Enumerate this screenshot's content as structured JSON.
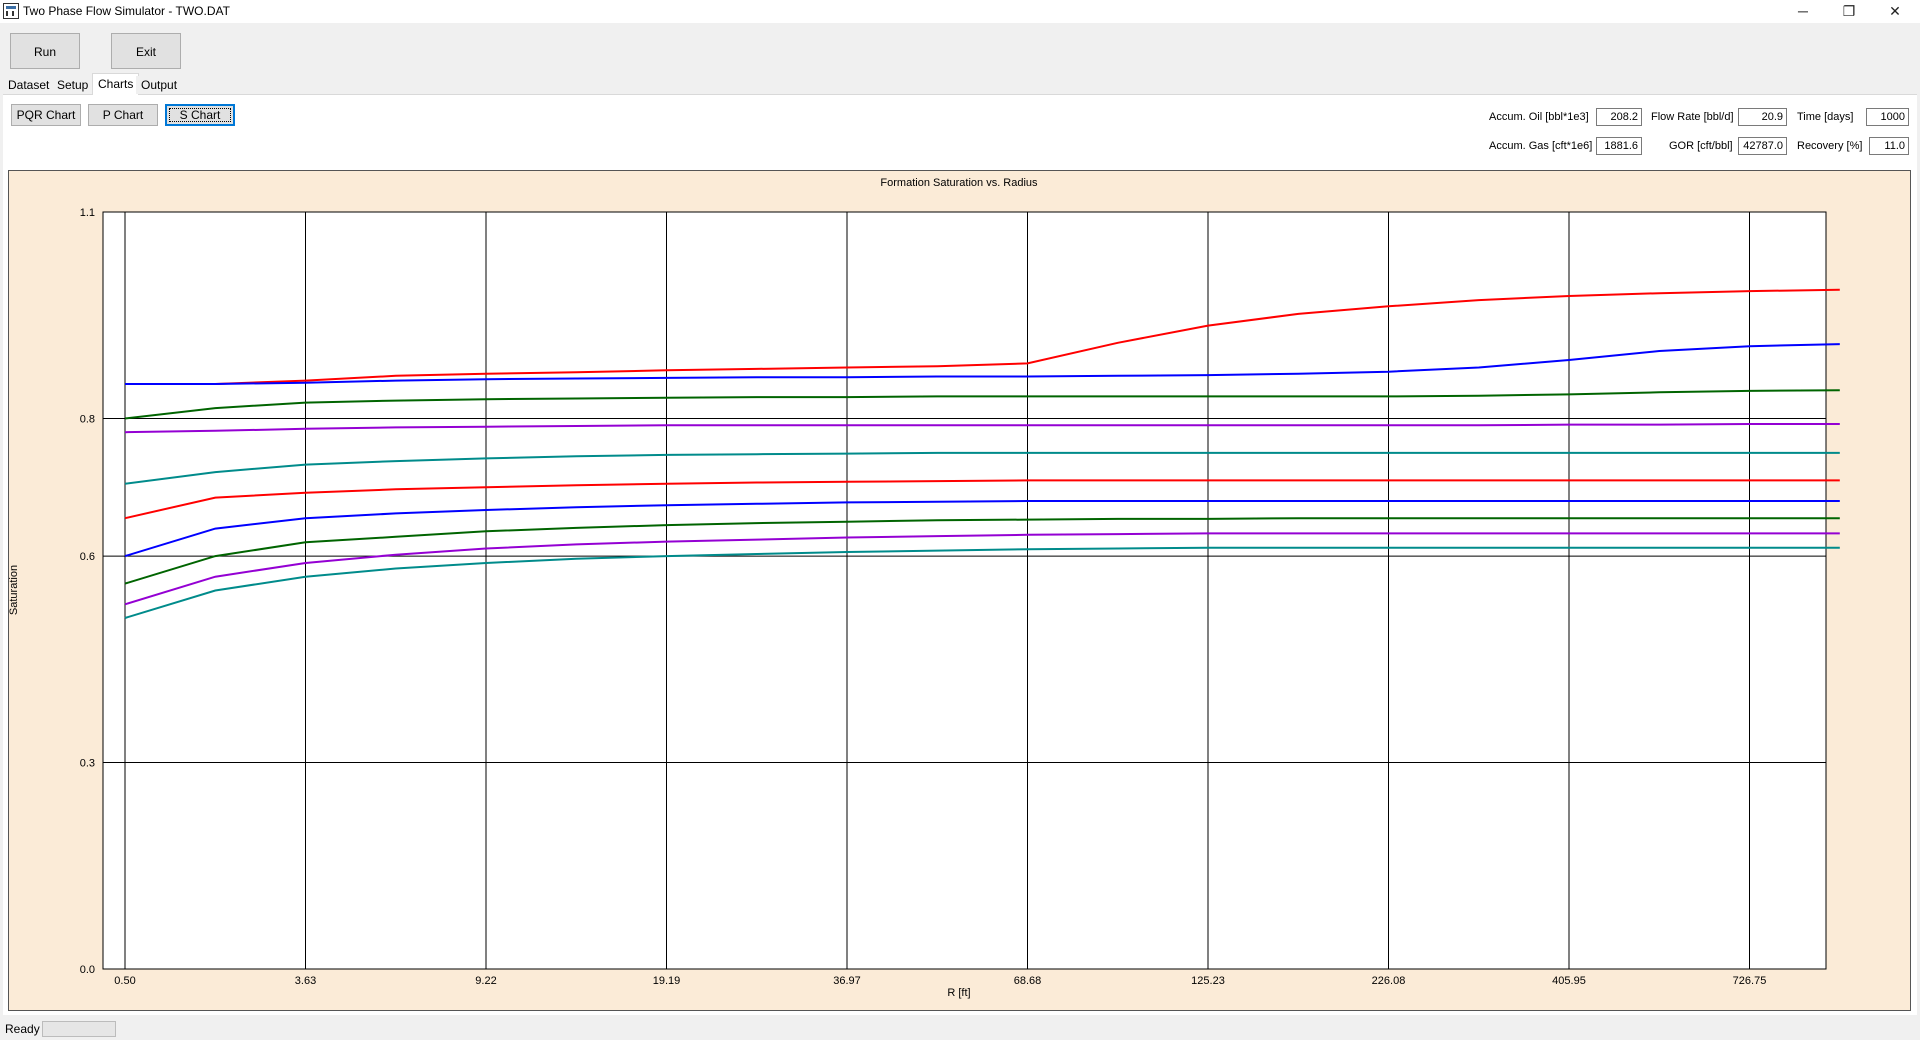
{
  "window": {
    "title": "Two Phase Flow Simulator - TWO.DAT",
    "minimize": "─",
    "restore": "❐",
    "close": "✕"
  },
  "toolbar": {
    "run_label": "Run",
    "exit_label": "Exit"
  },
  "tabs": [
    {
      "label": "Dataset"
    },
    {
      "label": "Setup"
    },
    {
      "label": "Charts",
      "active": true
    },
    {
      "label": "Output"
    }
  ],
  "chart_buttons": [
    {
      "label": "PQR Chart"
    },
    {
      "label": "P Chart"
    },
    {
      "label": "S Chart",
      "selected": true
    }
  ],
  "stats": {
    "accum_oil_label": "Accum. Oil [bbl*1e3]",
    "accum_oil": "208.2",
    "flow_rate_label": "Flow Rate [bbl/d]",
    "flow_rate": "20.9",
    "time_label": "Time [days]",
    "time": "1000",
    "accum_gas_label": "Accum. Gas [cft*1e6]",
    "accum_gas": "1881.6",
    "gor_label": "GOR [cft/bbl]",
    "gor": "42787.0",
    "recovery_label": "Recovery [%]",
    "recovery": "11.0"
  },
  "status": {
    "text": "Ready"
  },
  "chart_data": {
    "type": "line",
    "title": "Formation Saturation vs. Radius",
    "xlabel": "R [ft]",
    "ylabel": "Saturation",
    "ylim": [
      0.0,
      1.1
    ],
    "x_tick_labels": [
      "0.50",
      "3.63",
      "9.22",
      "19.19",
      "36.97",
      "68.68",
      "125.23",
      "226.08",
      "405.95",
      "726.75"
    ],
    "y_tick_labels": [
      "0.0",
      "0.3",
      "0.6",
      "0.8",
      "1.1"
    ],
    "grid": true,
    "x_index": [
      0,
      0.5,
      1,
      1.5,
      2,
      2.5,
      3,
      3.5,
      4,
      4.5,
      5,
      5.5,
      6,
      6.5,
      7,
      7.5,
      8,
      8.5,
      9,
      9.5
    ],
    "series": [
      {
        "color": "#ff0000",
        "values": [
          0.85,
          0.85,
          0.855,
          0.862,
          0.865,
          0.867,
          0.87,
          0.872,
          0.874,
          0.876,
          0.88,
          0.91,
          0.935,
          0.952,
          0.963,
          0.972,
          0.978,
          0.982,
          0.985,
          0.987
        ]
      },
      {
        "color": "#0000ff",
        "values": [
          0.85,
          0.85,
          0.852,
          0.855,
          0.857,
          0.858,
          0.859,
          0.86,
          0.86,
          0.861,
          0.861,
          0.862,
          0.863,
          0.865,
          0.868,
          0.874,
          0.885,
          0.898,
          0.905,
          0.908
        ]
      },
      {
        "color": "#006400",
        "values": [
          0.8,
          0.815,
          0.823,
          0.826,
          0.828,
          0.829,
          0.83,
          0.831,
          0.831,
          0.832,
          0.832,
          0.832,
          0.832,
          0.832,
          0.832,
          0.833,
          0.835,
          0.838,
          0.84,
          0.841
        ]
      },
      {
        "color": "#9400d3",
        "values": [
          0.78,
          0.782,
          0.785,
          0.787,
          0.788,
          0.789,
          0.79,
          0.79,
          0.79,
          0.79,
          0.79,
          0.79,
          0.79,
          0.79,
          0.79,
          0.79,
          0.791,
          0.791,
          0.792,
          0.792
        ]
      },
      {
        "color": "#008b8b",
        "values": [
          0.705,
          0.722,
          0.733,
          0.738,
          0.742,
          0.745,
          0.747,
          0.748,
          0.749,
          0.75,
          0.75,
          0.75,
          0.75,
          0.75,
          0.75,
          0.75,
          0.75,
          0.75,
          0.75,
          0.75
        ]
      },
      {
        "color": "#ff0000",
        "values": [
          0.655,
          0.685,
          0.692,
          0.697,
          0.7,
          0.703,
          0.705,
          0.707,
          0.708,
          0.709,
          0.71,
          0.71,
          0.71,
          0.71,
          0.71,
          0.71,
          0.71,
          0.71,
          0.71,
          0.71
        ]
      },
      {
        "color": "#0000ff",
        "values": [
          0.6,
          0.64,
          0.655,
          0.662,
          0.667,
          0.671,
          0.674,
          0.676,
          0.678,
          0.679,
          0.68,
          0.68,
          0.68,
          0.68,
          0.68,
          0.68,
          0.68,
          0.68,
          0.68,
          0.68
        ]
      },
      {
        "color": "#006400",
        "values": [
          0.56,
          0.6,
          0.62,
          0.628,
          0.636,
          0.641,
          0.645,
          0.648,
          0.65,
          0.652,
          0.653,
          0.654,
          0.654,
          0.655,
          0.655,
          0.655,
          0.655,
          0.655,
          0.655,
          0.655
        ]
      },
      {
        "color": "#9400d3",
        "values": [
          0.53,
          0.57,
          0.59,
          0.602,
          0.611,
          0.617,
          0.621,
          0.624,
          0.627,
          0.629,
          0.631,
          0.632,
          0.633,
          0.633,
          0.633,
          0.633,
          0.633,
          0.633,
          0.633,
          0.633
        ]
      },
      {
        "color": "#008b8b",
        "values": [
          0.51,
          0.55,
          0.57,
          0.582,
          0.59,
          0.596,
          0.6,
          0.603,
          0.606,
          0.608,
          0.61,
          0.611,
          0.612,
          0.612,
          0.612,
          0.612,
          0.612,
          0.612,
          0.612,
          0.612
        ]
      }
    ]
  }
}
